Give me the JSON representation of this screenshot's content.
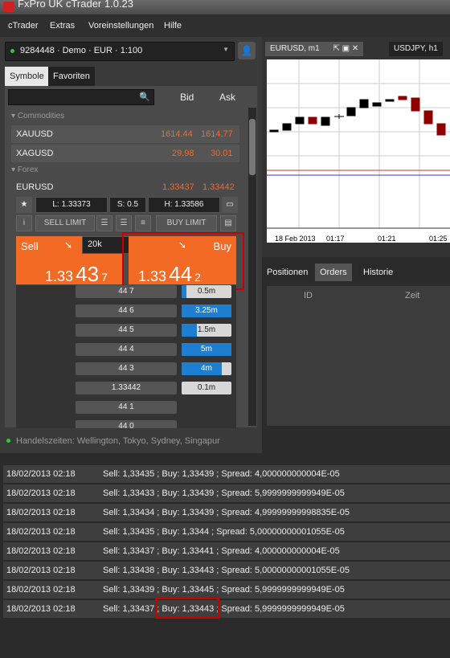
{
  "app": {
    "title": "FxPro UK cTrader 1.0.23"
  },
  "menu": [
    "cTrader",
    "Extras",
    "Voreinstellungen",
    "Hilfe"
  ],
  "account": {
    "label": "9284448 · Demo · EUR · 1:100"
  },
  "tabs": [
    {
      "label": "Symbole"
    },
    {
      "label": "Favoriten"
    }
  ],
  "symbol_list": {
    "col_bid": "Bid",
    "col_ask": "Ask",
    "groups": [
      {
        "name": "Commodities",
        "rows": [
          {
            "symbol": "XAUUSD",
            "bid": "1614.44",
            "ask": "1614.77"
          },
          {
            "symbol": "XAGUSD",
            "bid": "29.98",
            "ask": "30.01"
          }
        ]
      },
      {
        "name": "Forex",
        "rows": [
          {
            "symbol": "EURUSD",
            "bid": "1.33437",
            "ask": "1.33442"
          }
        ]
      }
    ]
  },
  "info": {
    "low": "L: 1.33373",
    "spread": "S: 0.5",
    "high": "H: 1.33586"
  },
  "orders": {
    "sell_limit": "SELL LIMIT",
    "buy_limit": "BUY LIMIT"
  },
  "trade": {
    "sell_label": "Sell",
    "buy_label": "Buy",
    "amount": "20k",
    "sell_price": {
      "big": "1.33",
      "pip": "43",
      "frac": "7"
    },
    "buy_price": {
      "big": "1.33",
      "pip": "44",
      "frac": "2"
    }
  },
  "ladder": [
    {
      "price": "44 7",
      "volume": "0.5m",
      "fill": 0.1
    },
    {
      "price": "44 6",
      "volume": "3.25m",
      "fill": 1.0
    },
    {
      "price": "44 5",
      "volume": "1.5m",
      "fill": 0.3
    },
    {
      "price": "44 4",
      "volume": "5m",
      "fill": 1.0
    },
    {
      "price": "44 3",
      "volume": "4m",
      "fill": 0.8
    },
    {
      "price": "1.33442",
      "volume": "0.1m",
      "fill": 0.0
    },
    {
      "price": "44 1",
      "volume": "",
      "fill": 0.0
    },
    {
      "price": "44 0",
      "volume": "",
      "fill": 0.0
    }
  ],
  "trading_hours": "Handelszeiten: Wellington, Tokyo, Sydney, Singapur",
  "chart_tabs": [
    {
      "label": "EURUSD, m1"
    },
    {
      "label": "USDJPY, h1"
    }
  ],
  "chart_axis": {
    "date": "18 Feb 2013",
    "t1": "01:17",
    "t2": "01:21",
    "t3": "01:25"
  },
  "bottom_tabs": [
    {
      "label": "Positionen"
    },
    {
      "label": "Orders"
    },
    {
      "label": "Historie"
    }
  ],
  "order_cols": {
    "id": "ID",
    "zeit": "Zeit"
  },
  "log": [
    {
      "date": "18/02/2013 02:18",
      "msg": "Sell: 1,33435 ; Buy: 1,33439 ; Spread: 4,000000000004E-05"
    },
    {
      "date": "18/02/2013 02:18",
      "msg": "Sell: 1,33433 ; Buy: 1,33439 ; Spread: 5,9999999999949E-05"
    },
    {
      "date": "18/02/2013 02:18",
      "msg": "Sell: 1,33434 ; Buy: 1,33439 ; Spread: 4,99999999998835E-05"
    },
    {
      "date": "18/02/2013 02:18",
      "msg": "Sell: 1,33435 ; Buy: 1,3344 ; Spread: 5,00000000001055E-05"
    },
    {
      "date": "18/02/2013 02:18",
      "msg": "Sell: 1,33437 ; Buy: 1,33441 ; Spread: 4,000000000004E-05"
    },
    {
      "date": "18/02/2013 02:18",
      "msg": "Sell: 1,33438 ; Buy: 1,33443 ; Spread: 5,00000000001055E-05"
    },
    {
      "date": "18/02/2013 02:18",
      "msg": "Sell: 1,33439 ; Buy: 1,33445 ; Spread: 5,9999999999949E-05"
    },
    {
      "date": "18/02/2013 02:18",
      "msg": "Sell: 1,33437 ; Buy: 1,33443 ; Spread: 5,9999999999949E-05"
    }
  ]
}
